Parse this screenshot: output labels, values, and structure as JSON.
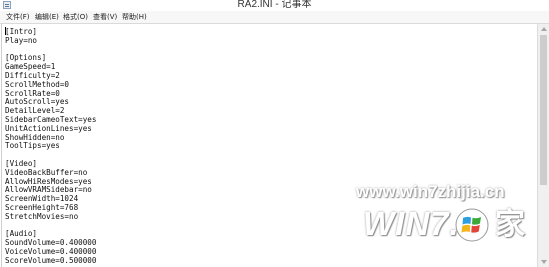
{
  "window": {
    "title": "RA2.INI - 记事本"
  },
  "menu": {
    "items": [
      {
        "label": "文件(F)"
      },
      {
        "label": "编辑(E)"
      },
      {
        "label": "格式(O)"
      },
      {
        "label": "查看(V)"
      },
      {
        "label": "帮助(H)"
      }
    ]
  },
  "editor": {
    "lines": [
      "[Intro]",
      "Play=no",
      "",
      "[Options]",
      "GameSpeed=1",
      "Difficulty=2",
      "ScrollMethod=0",
      "ScrollRate=0",
      "AutoScroll=yes",
      "DetailLevel=2",
      "SidebarCameoText=yes",
      "UnitActionLines=yes",
      "ShowHidden=no",
      "ToolTips=yes",
      "",
      "[Video]",
      "VideoBackBuffer=no",
      "AllowHiResModes=yes",
      "AllowVRAMSidebar=no",
      "ScreenWidth=1024",
      "ScreenHeight=768",
      "StretchMovies=no",
      "",
      "[Audio]",
      "SoundVolume=0.400000",
      "VoiceVolume=0.400000",
      "ScoreVolume=0.500000"
    ]
  },
  "watermark": {
    "url": "www.win7zhijia.cn",
    "logo_text": "WIN7.",
    "logo_char": "家",
    "flag_colors": [
      "#2d9ee0",
      "#3aa93a",
      "#f2b61c",
      "#e2443a"
    ]
  },
  "icons": {
    "app": "notepad-icon",
    "flag": "windows-flag-icon"
  }
}
